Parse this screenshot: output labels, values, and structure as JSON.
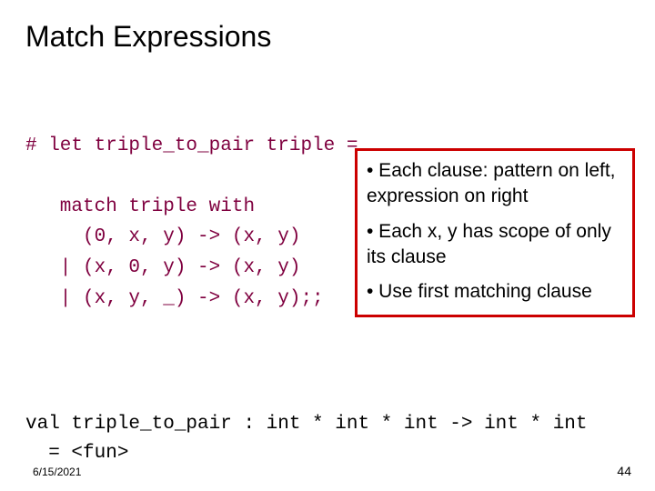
{
  "title": "Match Expressions",
  "code": {
    "line1": "# let triple_to_pair triple =",
    "line2": "   match triple with",
    "line3": "     (0, x, y) -> (x, y)",
    "line4": "   | (x, 0, y) -> (x, y)",
    "line5": "   | (x, y, _) -> (x, y);;"
  },
  "callout": {
    "b1": "• Each clause: pattern on left, expression on right",
    "b2": "• Each x, y has scope of only its clause",
    "b3": "• Use first matching clause"
  },
  "val": {
    "line1": "val triple_to_pair : int * int * int -> int * int",
    "line2": "  = <fun>"
  },
  "footer": {
    "date": "6/15/2021",
    "page": "44"
  }
}
